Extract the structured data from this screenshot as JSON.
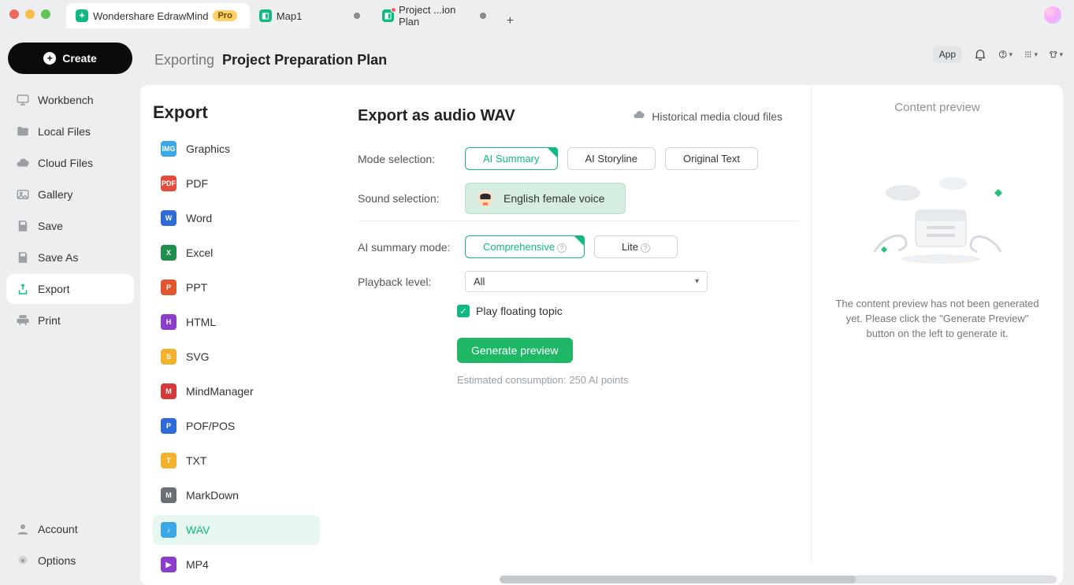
{
  "titlebar": {
    "tabs": [
      {
        "label": "Wondershare EdrawMind",
        "pro": "Pro"
      },
      {
        "label": "Map1"
      },
      {
        "label": "Project ...ion Plan"
      }
    ]
  },
  "leftnav": {
    "create": "Create",
    "items": [
      "Workbench",
      "Local Files",
      "Cloud Files",
      "Gallery",
      "Save",
      "Save As",
      "Export",
      "Print"
    ],
    "footer": [
      "Account",
      "Options"
    ]
  },
  "header": {
    "crumb": "Exporting",
    "title": "Project Preparation Plan",
    "app_chip": "App"
  },
  "export": {
    "title": "Export",
    "formats": [
      "Graphics",
      "PDF",
      "Word",
      "Excel",
      "PPT",
      "HTML",
      "SVG",
      "MindManager",
      "POF/POS",
      "TXT",
      "MarkDown",
      "WAV",
      "MP4"
    ]
  },
  "panel": {
    "heading": "Export as audio WAV",
    "cloud_link": "Historical media cloud files",
    "labels": {
      "mode": "Mode selection:",
      "sound": "Sound selection:",
      "ai_mode": "AI summary mode:",
      "playback": "Playback level:"
    },
    "modes": {
      "ai_summary": "AI Summary",
      "ai_storyline": "AI Storyline",
      "original": "Original Text"
    },
    "voice": "English female voice",
    "ai_modes": {
      "comprehensive": "Comprehensive",
      "lite": "Lite"
    },
    "playback_value": "All",
    "play_floating": "Play floating topic",
    "generate": "Generate preview",
    "estimate": "Estimated consumption: 250 AI points"
  },
  "preview": {
    "title": "Content preview",
    "message": "The content preview has not been generated yet. Please click the \"Generate Preview\" button on the left to generate it."
  }
}
